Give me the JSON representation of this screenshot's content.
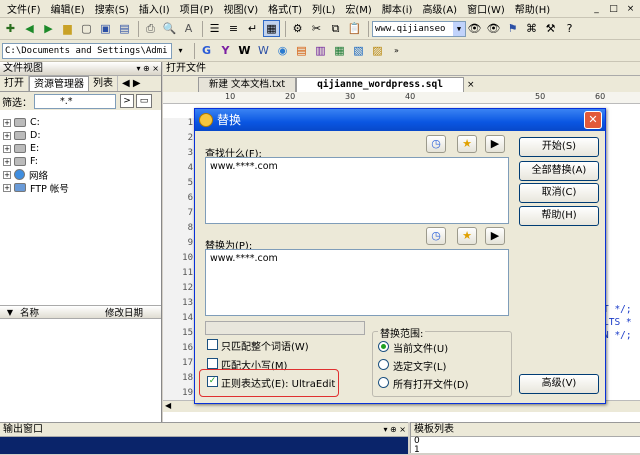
{
  "menubar": {
    "items": [
      "文件(F)",
      "编辑(E)",
      "搜索(S)",
      "插入(I)",
      "项目(P)",
      "视图(V)",
      "格式(T)",
      "列(L)",
      "宏(M)",
      "脚本(i)",
      "高级(A)",
      "窗口(W)",
      "帮助(H)"
    ],
    "sys_buttons": [
      "_",
      "□",
      "×"
    ]
  },
  "toolbar1": {
    "search_combo_value": "www.qijianseo"
  },
  "toolbar2": {
    "path_value": "C:\\Documents and Settings\\Admi"
  },
  "left_panel": {
    "title": "文件视图",
    "tabs": [
      "打开",
      "资源管理器",
      "列表"
    ],
    "filter_label": "筛选：",
    "filter_value": "*.*",
    "tree": [
      {
        "label": "C:"
      },
      {
        "label": "D:"
      },
      {
        "label": "E:"
      },
      {
        "label": "F:"
      },
      {
        "label": "网络"
      },
      {
        "label": "FTP 帐号"
      }
    ],
    "columns": [
      "名称",
      "修改日期"
    ]
  },
  "editor": {
    "panel_title": "打开文件",
    "tabs": [
      "新建 文本文档.txt",
      "qijianne_wordpress.sql"
    ],
    "ruler_marks": [
      "10",
      "20",
      "30",
      "40",
      "50",
      "60"
    ],
    "line_numbers": [
      "1",
      "2",
      "3",
      "4",
      "5",
      "6",
      "7",
      "8",
      "9",
      "10",
      "11",
      "12",
      "13",
      "14",
      "15",
      "16",
      "17",
      "18",
      "19"
    ],
    "visible_code": [
      "T */;",
      "LTS *",
      "N */;"
    ]
  },
  "dialog": {
    "title": "替换",
    "find_label": "查找什么(F):",
    "find_value": "www.****.com",
    "replace_label": "替换为(P):",
    "replace_value": "www.****.com",
    "buttons": {
      "start": "开始(S)",
      "replace_all": "全部替换(A)",
      "cancel": "取消(C)",
      "help": "帮助(H)",
      "advanced": "高级(V)"
    },
    "options": {
      "match_word": "只匹配整个词语(W)",
      "match_case": "匹配大小写(M)",
      "regex": "正则表达式(E): UltraEdit"
    },
    "scope": {
      "title": "替换范围:",
      "current_file": "当前文件(U)",
      "selected_text": "选定文字(L)",
      "all_open": "所有打开文件(D)"
    }
  },
  "bottom": {
    "output_title": "输出窗口",
    "template_title": "模板列表",
    "template_lines": [
      "0",
      "1"
    ]
  }
}
